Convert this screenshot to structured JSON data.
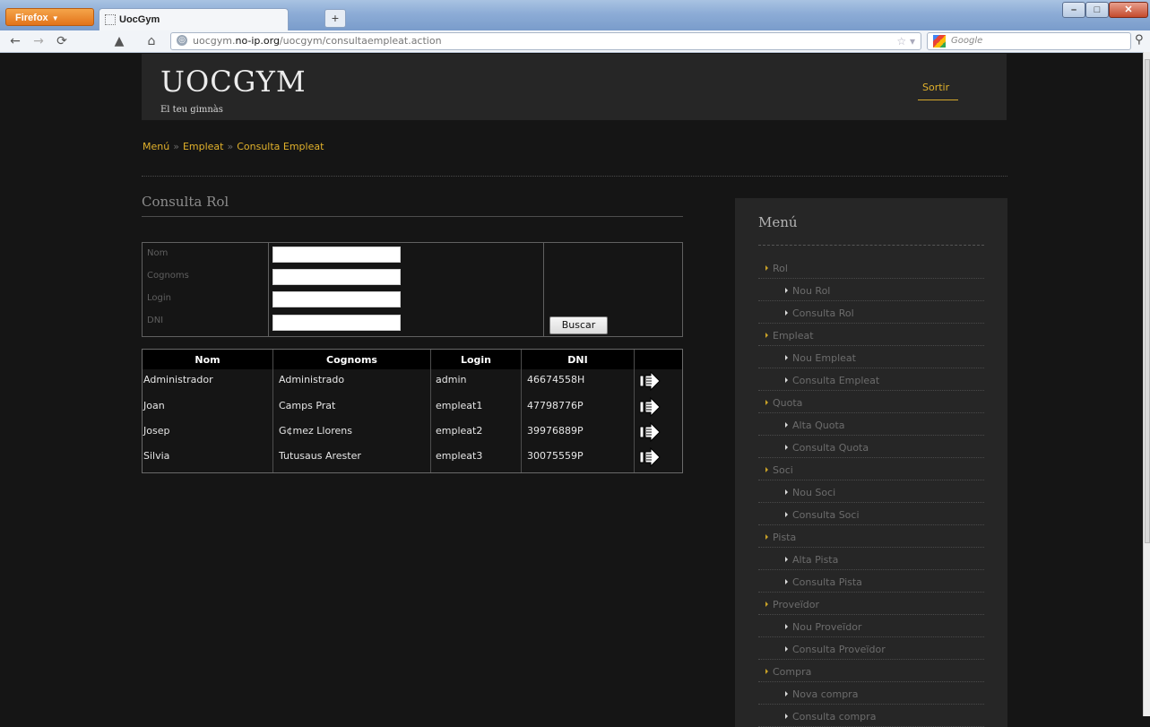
{
  "browser": {
    "app_button": "Firefox",
    "tab_title": "UocGym",
    "new_tab": "+",
    "url_domain_pre": "uocgym.",
    "url_domain_main": "no-ip.org",
    "url_path": "/uocgym/consultaempleat.action",
    "search_placeholder": "Google",
    "win_min": "–",
    "win_max": "□",
    "win_close": "✕"
  },
  "header": {
    "logo": "UOCGYM",
    "tagline": "El teu gimnàs",
    "logout": "Sortir"
  },
  "breadcrumb": {
    "items": [
      "Menú",
      "Empleat",
      "Consulta Empleat"
    ],
    "separator": "»"
  },
  "section_title": "Consulta Rol",
  "search_form": {
    "fields": [
      {
        "label": "Nom",
        "value": ""
      },
      {
        "label": "Cognoms",
        "value": ""
      },
      {
        "label": "Login",
        "value": ""
      },
      {
        "label": "DNI",
        "value": ""
      }
    ],
    "submit": "Buscar"
  },
  "results": {
    "columns": [
      "Nom",
      "Cognoms",
      "Login",
      "DNI",
      ""
    ],
    "rows": [
      {
        "nom": "Administrador",
        "cognoms": "Administrado",
        "login": "admin",
        "dni": "46674558H"
      },
      {
        "nom": "Joan",
        "cognoms": "Camps Prat",
        "login": "empleat1",
        "dni": "47798776P"
      },
      {
        "nom": "Josep",
        "cognoms": "G¢mez Llorens",
        "login": "empleat2",
        "dni": "39976889P"
      },
      {
        "nom": "Silvia",
        "cognoms": "Tutusaus Arester",
        "login": "empleat3",
        "dni": "30075559P"
      }
    ]
  },
  "sidebar": {
    "title": "Menú",
    "items": [
      {
        "label": "Rol",
        "level": 0
      },
      {
        "label": "Nou Rol",
        "level": 1
      },
      {
        "label": "Consulta Rol",
        "level": 1
      },
      {
        "label": "Empleat",
        "level": 0
      },
      {
        "label": "Nou Empleat",
        "level": 1
      },
      {
        "label": "Consulta Empleat",
        "level": 1
      },
      {
        "label": "Quota",
        "level": 0
      },
      {
        "label": "Alta Quota",
        "level": 1
      },
      {
        "label": "Consulta Quota",
        "level": 1
      },
      {
        "label": "Soci",
        "level": 0
      },
      {
        "label": "Nou Soci",
        "level": 1
      },
      {
        "label": "Consulta Soci",
        "level": 1
      },
      {
        "label": "Pista",
        "level": 0
      },
      {
        "label": "Alta Pista",
        "level": 1
      },
      {
        "label": "Consulta Pista",
        "level": 1
      },
      {
        "label": "Proveïdor",
        "level": 0
      },
      {
        "label": "Nou Proveïdor",
        "level": 1
      },
      {
        "label": "Consulta Proveïdor",
        "level": 1
      },
      {
        "label": "Compra",
        "level": 0
      },
      {
        "label": "Nova compra",
        "level": 1
      },
      {
        "label": "Consulta compra",
        "level": 1
      }
    ]
  },
  "colors": {
    "accent": "#e1b12b",
    "page_bg": "#151515",
    "panel_bg": "#262626"
  }
}
